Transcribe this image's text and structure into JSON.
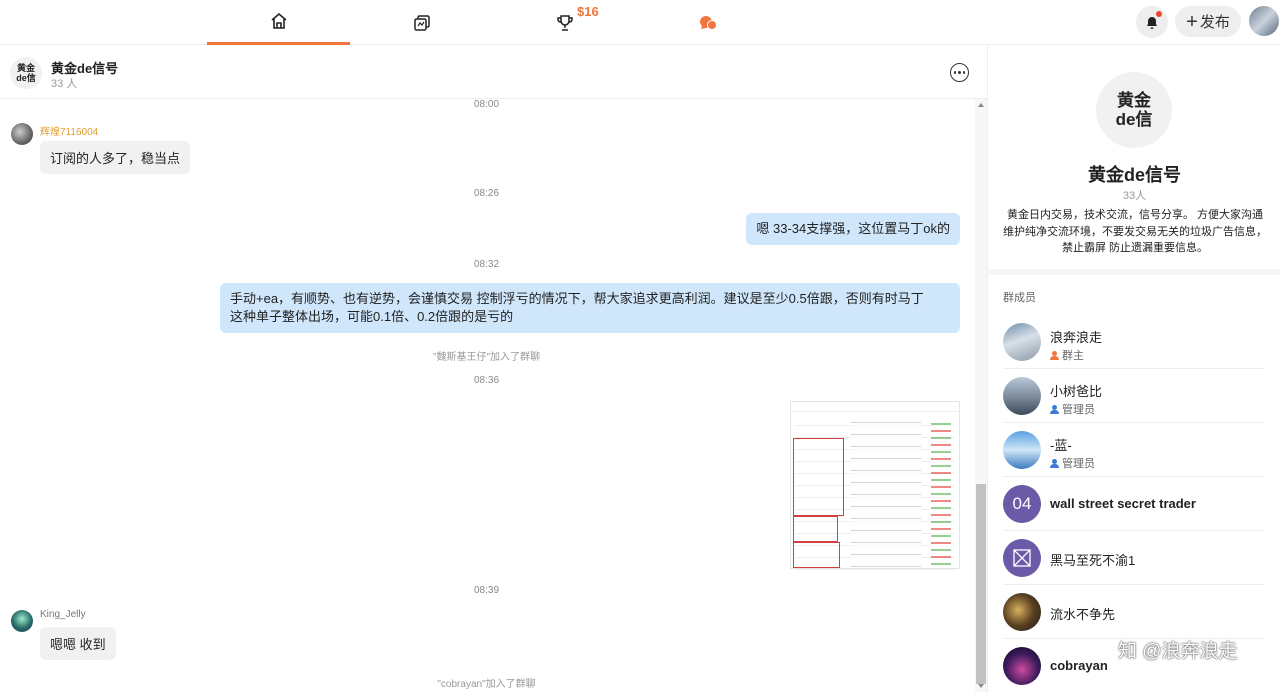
{
  "topbar": {
    "tabs": [
      {
        "name": "home",
        "active": true
      },
      {
        "name": "feed",
        "active": false
      },
      {
        "name": "trophy",
        "active": false,
        "badge": "$16"
      },
      {
        "name": "chat",
        "active": false
      }
    ],
    "publish_label": "发布",
    "accent_color": "#f0763e"
  },
  "chat": {
    "title": "黄金de信号",
    "member_count": "33 人",
    "avatar_text": "黄金de信号",
    "messages": [
      {
        "type": "timestamp",
        "text": "08:00"
      },
      {
        "type": "incoming",
        "sender": "辉煌7116004",
        "text": "订阅的人多了，稳当点"
      },
      {
        "type": "timestamp",
        "text": "08:26"
      },
      {
        "type": "outgoing",
        "text": "嗯 33-34支撑强，这位置马丁ok的"
      },
      {
        "type": "timestamp",
        "text": "08:32"
      },
      {
        "type": "outgoing",
        "line1": "手动+ea，有顺势、也有逆势，会谨慎交易 控制浮亏的情况下，帮大家追求更高利润。建议是至少0.5倍跟，否则有时马丁",
        "line2": "这种单子整体出场，可能0.1倍、0.2倍跟的是亏的"
      },
      {
        "type": "system",
        "text": "\"魏斯基王仔\"加入了群聊"
      },
      {
        "type": "timestamp",
        "text": "08:36"
      },
      {
        "type": "image",
        "description": "trade-screenshot"
      },
      {
        "type": "timestamp",
        "text": "08:39"
      },
      {
        "type": "incoming",
        "sender": "King_Jelly",
        "text": "嗯嗯 收到"
      },
      {
        "type": "system",
        "text": "\"cobrayan\"加入了群聊"
      }
    ]
  },
  "side": {
    "avatar_line1": "黄金",
    "avatar_line2": "de信",
    "title": "黄金de信号",
    "count": "33人",
    "description": "黄金日内交易，技术交流，信号分享。 方便大家沟通 维护纯净交流环境，不要发交易无关的垃圾广告信息，禁止霸屏 防止遗漏重要信息。",
    "members_title": "群成员",
    "members": [
      {
        "name": "浪奔浪走",
        "role": "群主",
        "role_color": "#f0763e"
      },
      {
        "name": "小树爸比",
        "role": "管理员",
        "role_color": "#3a7bd5"
      },
      {
        "name": "-蓝-",
        "role": "管理员",
        "role_color": "#3a7bd5"
      },
      {
        "name": "wall street secret trader",
        "avatar_text": "04",
        "role": ""
      },
      {
        "name": "黑马至死不渝1",
        "role": ""
      },
      {
        "name": "流水不争先",
        "role": ""
      },
      {
        "name": "cobrayan",
        "role": ""
      }
    ]
  },
  "watermark": "知 @浪奔浪走"
}
